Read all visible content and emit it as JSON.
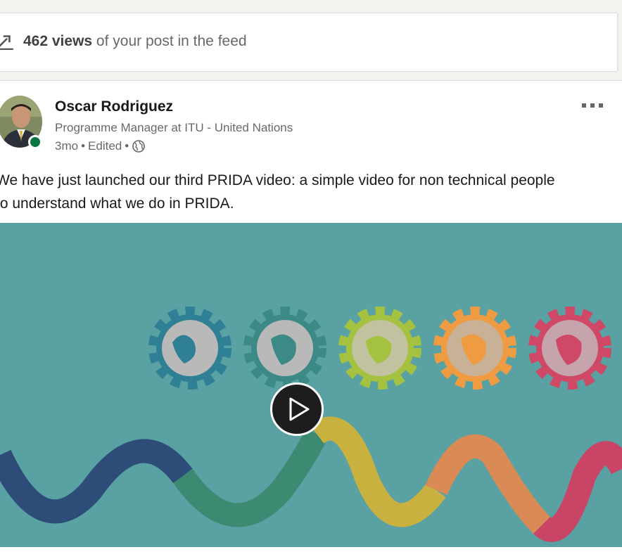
{
  "stats": {
    "views_count": "462 views",
    "views_suffix": " of your post in the feed"
  },
  "post": {
    "author": {
      "name": "Oscar Rodriguez",
      "headline": "Programme Manager at ITU - United Nations",
      "time": "3mo",
      "edited": "Edited",
      "separator": "•",
      "visibility_icon": "globe-icon",
      "presence": "online"
    },
    "text_line1": "We have just launched our third PRIDA video: a simple video for non technical people",
    "text_line2": "to understand what we do in PRIDA.",
    "video": {
      "poster_background": "#5aa1a4",
      "gear_colors": [
        "#2f7f95",
        "#3c8a86",
        "#a4c23f",
        "#ef9b42",
        "#cf4866"
      ],
      "play_icon": "play-icon"
    }
  },
  "colors": {
    "presence_green": "#057642",
    "page_background": "#f3f2ef"
  }
}
